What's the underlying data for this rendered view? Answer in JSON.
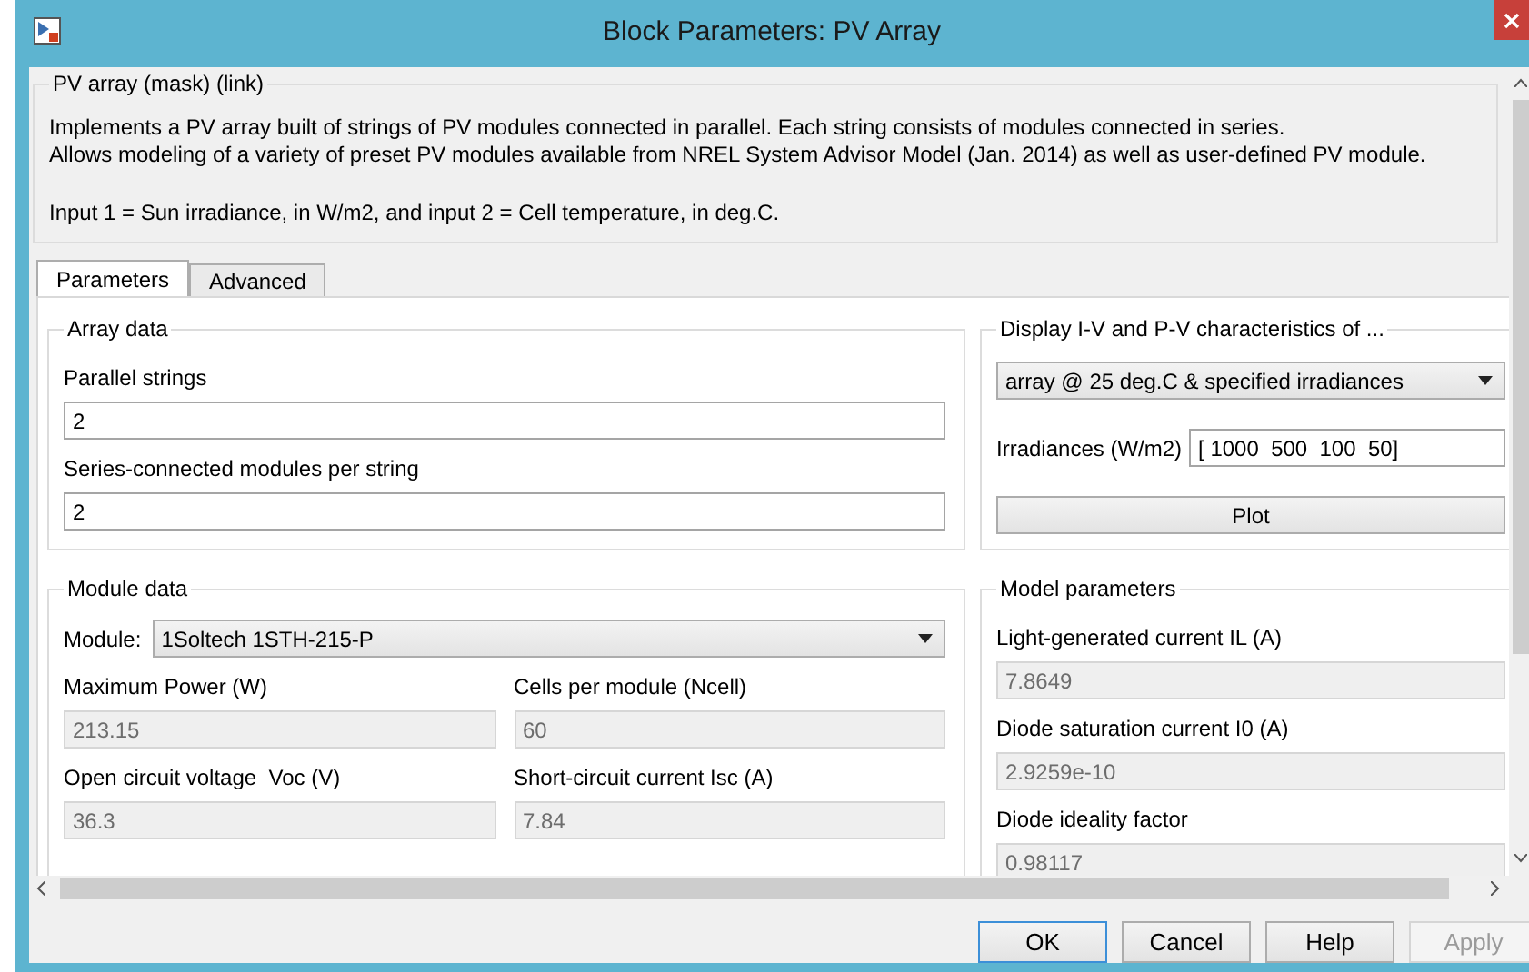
{
  "window": {
    "title": "Block Parameters: PV Array"
  },
  "description": {
    "title": "PV array (mask) (link)",
    "paragraphs": [
      {
        "lines": [
          "Implements a PV array built of strings of PV modules connected in parallel. Each string consists of modules connected in series.",
          "Allows modeling of a variety of preset PV modules available from NREL System Advisor Model (Jan. 2014) as well as user-defined PV module."
        ]
      },
      {
        "lines": [
          "Input 1 = Sun irradiance, in W/m2, and input 2 = Cell temperature, in deg.C."
        ]
      }
    ]
  },
  "tabs": [
    {
      "label": "Parameters",
      "selected": true
    },
    {
      "label": "Advanced",
      "selected": false
    }
  ],
  "array_data": {
    "title": "Array data",
    "fields": [
      {
        "label": "Parallel strings",
        "value": "2",
        "disabled": false
      },
      {
        "label": "Series-connected modules per string",
        "value": "2",
        "disabled": false
      }
    ]
  },
  "module_data": {
    "title": "Module data",
    "module": {
      "label": "Module:",
      "value": "1Soltech 1STH-215-P"
    },
    "fields": [
      {
        "label": "Maximum Power (W)",
        "value": "213.15",
        "disabled": true
      },
      {
        "label": "Cells per module (Ncell)",
        "value": "60",
        "disabled": true
      },
      {
        "label": "Open circuit voltage  Voc (V)",
        "value": "36.3",
        "disabled": true
      },
      {
        "label": "Short-circuit current Isc (A)",
        "value": "7.84",
        "disabled": true
      }
    ]
  },
  "display": {
    "title": "Display  I-V and P-V characteristics of ...",
    "selection": "array @ 25 deg.C & specified irradiances",
    "irradiances": {
      "label": "Irradiances (W/m2)",
      "value": "[ 1000  500  100  50]"
    },
    "plot_button": "Plot"
  },
  "model_parameters": {
    "title": "Model parameters",
    "fields": [
      {
        "label": "Light-generated current IL (A)",
        "value": "7.8649",
        "disabled": true
      },
      {
        "label": "Diode saturation current I0 (A)",
        "value": "2.9259e-10",
        "disabled": true
      },
      {
        "label": "Diode ideality factor",
        "value": "0.98117",
        "disabled": true
      }
    ]
  },
  "buttons": [
    {
      "label": "OK",
      "default": true,
      "disabled": false
    },
    {
      "label": "Cancel",
      "default": false,
      "disabled": false
    },
    {
      "label": "Help",
      "default": false,
      "disabled": false
    },
    {
      "label": "Apply",
      "default": false,
      "disabled": true
    }
  ]
}
